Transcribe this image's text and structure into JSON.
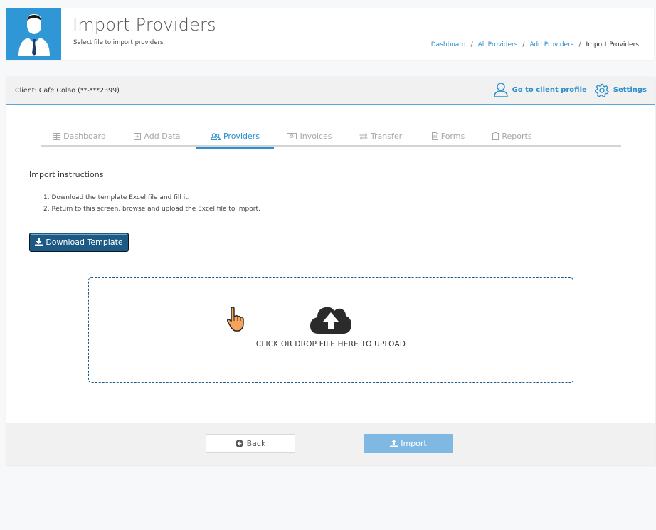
{
  "header": {
    "title": "Import Providers",
    "subtitle": "Select file to import providers.",
    "breadcrumb": [
      {
        "label": "Dashboard"
      },
      {
        "label": "All Providers"
      },
      {
        "label": "Add Providers"
      },
      {
        "label": "Import Providers"
      }
    ],
    "icon": "user-tie-icon"
  },
  "client_bar": {
    "client_label": "Client: Cafe Colao (**-***2399)",
    "profile_link": "Go to client profile",
    "settings_link": "Settings"
  },
  "tabs": [
    {
      "label": "Dashboard",
      "icon": "table-icon",
      "active": false
    },
    {
      "label": "Add Data",
      "icon": "plus-square-icon",
      "active": false
    },
    {
      "label": "Providers",
      "icon": "users-icon",
      "active": true
    },
    {
      "label": "Invoices",
      "icon": "money-bill-icon",
      "active": false
    },
    {
      "label": "Transfer",
      "icon": "exchange-icon",
      "active": false
    },
    {
      "label": "Forms",
      "icon": "file-text-icon",
      "active": false
    },
    {
      "label": "Reports",
      "icon": "clipboard-icon",
      "active": false
    }
  ],
  "instructions": {
    "title": "Import instructions",
    "steps": [
      "1. Download the template Excel file and fill it.",
      "2. Return to this screen, browse and upload the Excel file to import."
    ]
  },
  "download_button": "Download Template",
  "dropzone": {
    "text": "CLICK OR DROP FILE HERE TO UPLOAD"
  },
  "footer": {
    "back_label": "Back",
    "import_label": "Import"
  },
  "colors": {
    "accent": "#2b8fcd",
    "avatar_bg": "#2f97d6",
    "download_btn": "#1c5a85",
    "import_btn": "#7fb8e3"
  }
}
